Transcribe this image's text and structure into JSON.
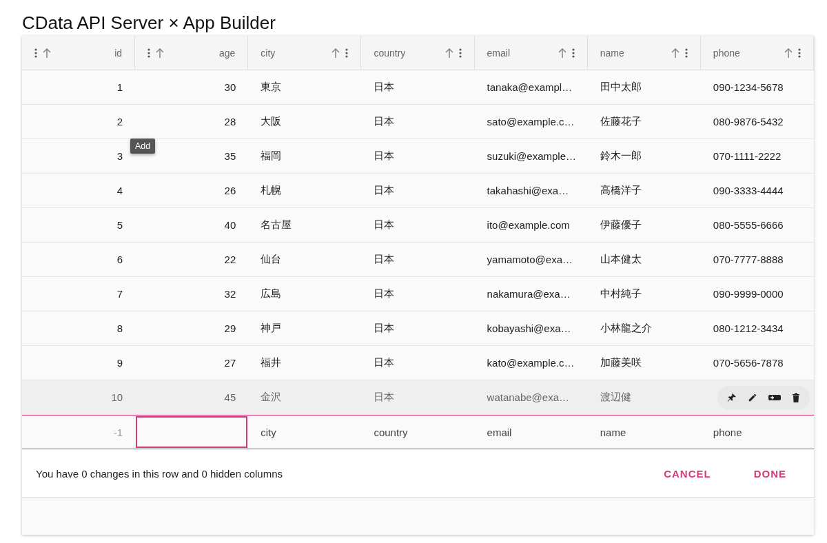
{
  "title": "CData API Server × App Builder",
  "columns": [
    {
      "label": "id",
      "kind": "number"
    },
    {
      "label": "age",
      "kind": "number"
    },
    {
      "label": "city",
      "kind": "text"
    },
    {
      "label": "country",
      "kind": "text"
    },
    {
      "label": "email",
      "kind": "text"
    },
    {
      "label": "name",
      "kind": "text"
    },
    {
      "label": "phone",
      "kind": "text"
    }
  ],
  "rows": [
    {
      "hovered": false,
      "cells": [
        "1",
        "30",
        "東京",
        "日本",
        "tanaka@exampl…",
        "田中太郎",
        "090-1234-5678"
      ]
    },
    {
      "hovered": false,
      "cells": [
        "2",
        "28",
        "大阪",
        "日本",
        "sato@example.c…",
        "佐藤花子",
        "080-9876-5432"
      ]
    },
    {
      "hovered": false,
      "cells": [
        "3",
        "35",
        "福岡",
        "日本",
        "suzuki@example…",
        "鈴木一郎",
        "070-1111-2222"
      ]
    },
    {
      "hovered": false,
      "cells": [
        "4",
        "26",
        "札幌",
        "日本",
        "takahashi@exa…",
        "高橋洋子",
        "090-3333-4444"
      ]
    },
    {
      "hovered": false,
      "cells": [
        "5",
        "40",
        "名古屋",
        "日本",
        "ito@example.com",
        "伊藤優子",
        "080-5555-6666"
      ]
    },
    {
      "hovered": false,
      "cells": [
        "6",
        "22",
        "仙台",
        "日本",
        "yamamoto@exa…",
        "山本健太",
        "070-7777-8888"
      ]
    },
    {
      "hovered": false,
      "cells": [
        "7",
        "32",
        "広島",
        "日本",
        "nakamura@exa…",
        "中村純子",
        "090-9999-0000"
      ]
    },
    {
      "hovered": false,
      "cells": [
        "8",
        "29",
        "神戸",
        "日本",
        "kobayashi@exa…",
        "小林龍之介",
        "080-1212-3434"
      ]
    },
    {
      "hovered": false,
      "cells": [
        "9",
        "27",
        "福井",
        "日本",
        "kato@example.c…",
        "加藤美咲",
        "070-5656-7878"
      ]
    },
    {
      "hovered": true,
      "cells": [
        "10",
        "45",
        "金沢",
        "日本",
        "watanabe@exa…",
        "渡辺健"
      ]
    }
  ],
  "add_row": {
    "id": "-1",
    "fields": [
      {
        "kind": "input"
      },
      {
        "kind": "placeholder",
        "text": "city"
      },
      {
        "kind": "placeholder",
        "text": "country"
      },
      {
        "kind": "placeholder",
        "text": "email"
      },
      {
        "kind": "placeholder",
        "text": "name"
      },
      {
        "kind": "placeholder",
        "text": "phone"
      }
    ]
  },
  "tooltip": {
    "text": "Add"
  },
  "footer": {
    "message": "You have 0 changes in this row and 0 hidden columns",
    "buttons": [
      "CANCEL",
      "DONE"
    ]
  }
}
